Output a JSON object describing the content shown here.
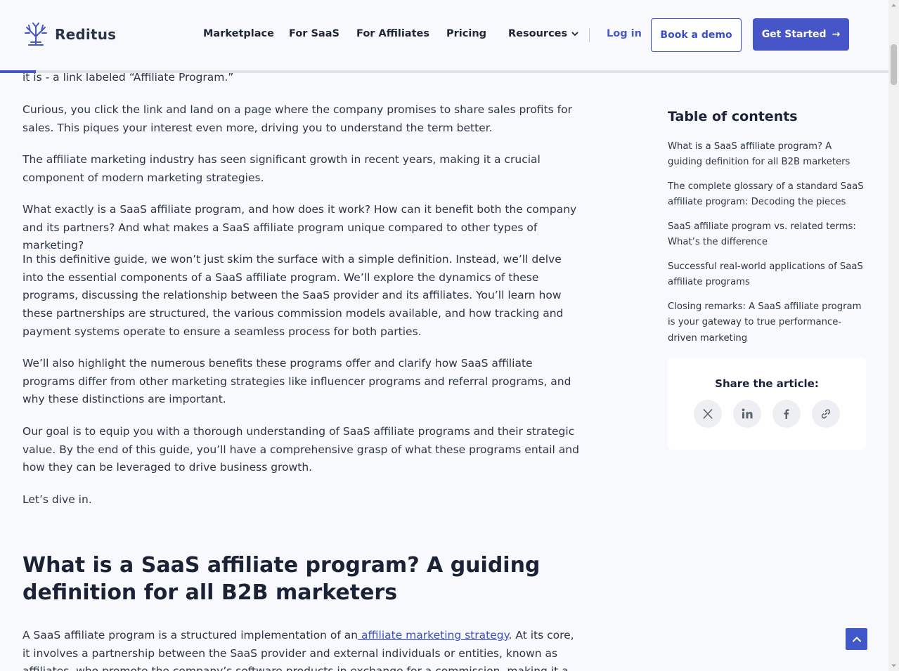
{
  "header": {
    "brand": "Reditus",
    "nav": [
      "Marketplace",
      "For SaaS",
      "For Affiliates",
      "Pricing",
      "Resources"
    ],
    "login": "Log in",
    "demo": "Book a demo",
    "start": "Get Started",
    "start_arrow": "→",
    "reading_progress": 0.04
  },
  "article": {
    "lead_fragment": "it is - a link labeled “Affiliate Program.”",
    "paragraphs": [
      "Curious, you click the link and land on a page where the company promises to share sales profits for sales. This piques your interest even more, driving you to understand the term better.",
      "The affiliate marketing industry has seen significant growth in recent years, making it a crucial component of modern marketing strategies.",
      "What exactly is a SaaS affiliate program, and how does it work? How can it benefit both the company and its partners? And what makes a SaaS affiliate program unique compared to other types of marketing?",
      "In this definitive guide, we won’t just skim the surface with a simple definition. Instead, we’ll delve into the essential components of a SaaS affiliate program. We’ll explore the dynamics of these programs, discussing the relationship between the SaaS provider and its affiliates. You’ll learn how these partnerships are structured, the various commission models available, and how tracking and payment systems operate to ensure a seamless process for both parties.",
      "We’ll also highlight the numerous benefits these programs offer and clarify how SaaS affiliate programs differ from other marketing strategies like influencer programs and referral programs, and why these distinctions are important.",
      "Our goal is to equip you with a thorough understanding of SaaS affiliate programs and their strategic value. By the end of this guide, you’ll have a comprehensive grasp of what these programs entail and how they can be leveraged to drive business growth.",
      "Let’s dive in."
    ],
    "heading": "What is a SaaS affiliate program? A guiding definition for all B2B marketers",
    "def_before": "A SaaS affiliate program is a structured implementation of an",
    "def_link": " affiliate marketing strategy",
    "def_after": ". At its core, it involves a partnership between the SaaS provider and external individuals or entities, known as affiliates, who promote the company’s software products in exchange for a commission, making it a vital part of any affiliate marketing"
  },
  "toc": {
    "title": "Table of contents",
    "items": [
      "What is a SaaS affiliate program? A guiding definition for all B2B marketers",
      "The complete glossary of a standard SaaS affiliate program: Decoding the pieces",
      "SaaS affiliate program vs. related terms: What’s the difference",
      "Successful real-world applications of SaaS affiliate programs",
      "Closing remarks: A SaaS affiliate program is your gateway to true performance-driven marketing"
    ]
  },
  "share": {
    "title": "Share the article:",
    "icons": [
      "x-icon",
      "linkedin-icon",
      "facebook-icon",
      "link-icon"
    ]
  },
  "colors": {
    "accent": "#4656c8",
    "text": "#2c3547",
    "background": "#f7f9fc"
  }
}
